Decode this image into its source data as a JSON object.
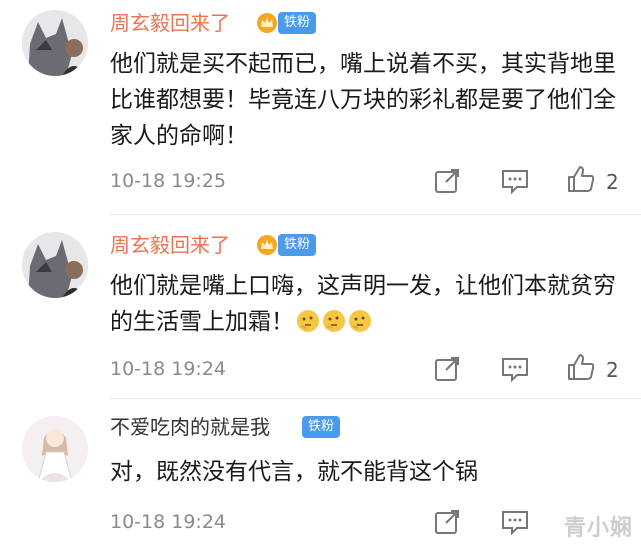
{
  "comments": [
    {
      "username": "周玄毅回来了",
      "badge": "铁粉",
      "text": "他们就是买不起而已，嘴上说着不买，其实背地里比谁都想要！毕竟连八万块的彩礼都是要了他们全家人的命啊！",
      "time": "10-18 19:25",
      "likes": "2",
      "emoji_count": 0
    },
    {
      "username": "周玄毅回来了",
      "badge": "铁粉",
      "text": "他们就是嘴上口嗨，这声明一发，让他们本就贫穷的生活雪上加霜！",
      "time": "10-18 19:24",
      "likes": "2",
      "emoji_count": 3
    },
    {
      "username": "不爱吃肉的就是我",
      "badge": "铁粉",
      "text": "对，既然没有代言，就不能背这个锅",
      "time": "10-18 19:24",
      "likes": "",
      "emoji_count": 0
    }
  ],
  "icons": {
    "share": "share-icon",
    "comment": "comment-icon",
    "like": "like-icon",
    "crown": "crown-icon",
    "emoji": "thinking-emoji-icon"
  },
  "colors": {
    "vip_username": "#eb7350",
    "badge_bg": "#4a9bec",
    "timestamp": "#8a8a8a"
  },
  "watermark": "青小娴"
}
